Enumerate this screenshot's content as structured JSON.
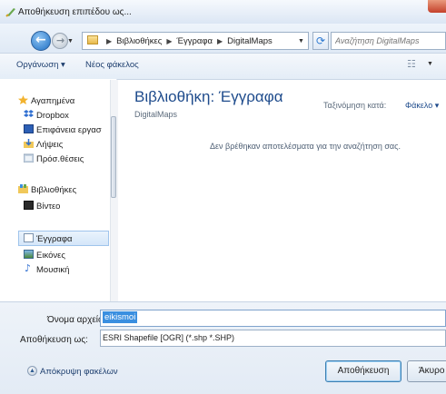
{
  "window": {
    "title": "Αποθήκευση επιπέδου ως..."
  },
  "address": {
    "crumbs": [
      "Βιβλιοθήκες",
      "Έγγραφα",
      "DigitalMaps"
    ],
    "search_placeholder": "Αναζήτηση DigitalMaps"
  },
  "toolbar": {
    "organize_label": "Οργάνωση ▾",
    "new_folder_label": "Νέος φάκελος"
  },
  "nav": {
    "favorites_label": "Αγαπημένα",
    "dropbox_label": "Dropbox",
    "desktop_label": "Επιφάνεια εργασ",
    "downloads_label": "Λήψεις",
    "recent_label": "Πρόσ.θέσεις",
    "libraries_label": "Βιβλιοθήκες",
    "videos_label": "Βίντεο",
    "documents_label": "Έγγραφα",
    "pictures_label": "Εικόνες",
    "music_label": "Μουσική"
  },
  "content": {
    "library_title": "Βιβλιοθήκη: Έγγραφα",
    "library_subtitle": "DigitalMaps",
    "arrange_label": "Ταξινόμηση κατά:",
    "arrange_value": "Φάκελο ▾",
    "empty_message": "Δεν βρέθηκαν αποτελέσματα για την αναζήτηση σας."
  },
  "form": {
    "filename_label": "Όνομα αρχείου:",
    "filename_value": "eikismoi",
    "filetype_label": "Αποθήκευση ως:",
    "filetype_value": "ESRI Shapefile [OGR] (*.shp *.SHP)"
  },
  "footer": {
    "hide_folders_label": "Απόκρυψη φακέλων",
    "save_label": "Αποθήκευση",
    "cancel_label": "Άκυρο"
  },
  "colors": {
    "accent": "#1e4b8c",
    "selection": "#3a8fe0"
  }
}
